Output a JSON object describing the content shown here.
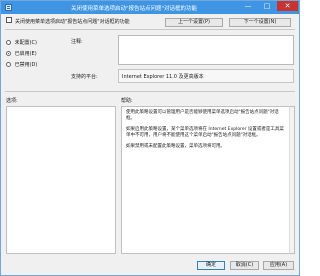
{
  "window": {
    "title": "关闭使用菜单选项启动\"报告站点问题\"对话框的功能",
    "minimize": "—",
    "maximize": "□",
    "close": "✕"
  },
  "header": {
    "setting_name": "关闭使用菜单选项启动\"报告站点问题\"对话框的功能"
  },
  "nav": {
    "prev_label": "上一个设置(P)",
    "next_label": "下一个设置(N)"
  },
  "state": {
    "options": [
      {
        "label": "未配置(C)",
        "checked": false
      },
      {
        "label": "已启用(E)",
        "checked": true
      },
      {
        "label": "已禁用(D)",
        "checked": false
      }
    ]
  },
  "comment": {
    "label": "注释:",
    "value": ""
  },
  "support": {
    "label": "支持的平台:",
    "value": "Internet Explorer 11.0 及更高版本"
  },
  "options_section": {
    "label": "选项:"
  },
  "help_section": {
    "label": "帮助:",
    "paragraphs": [
      "使用此策略设置可以管理用户是否能够使用菜单选项启动\"报告站点问题\"对话框。",
      "如果启用此策略设置，某个菜单选项将在 Internet Explorer 设置或者是工具菜单中不可用，用户将不能使用这个菜单启动\"报告站点问题\"对话框。",
      "如果禁用或未配置此策略设置，菜单选项将可用。"
    ]
  },
  "footer": {
    "ok_label": "确定",
    "cancel_label": "取消(C)",
    "apply_label": "应用(A)"
  },
  "colors": {
    "titlebar": "#3f95e3",
    "close_button": "#c7342f",
    "dialog_bg": "#f0f0f0"
  }
}
